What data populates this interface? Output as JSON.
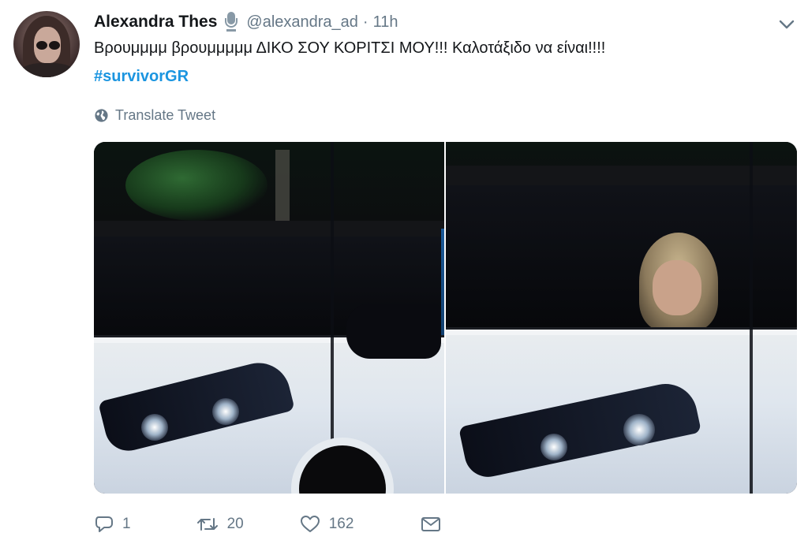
{
  "tweet": {
    "author_name": "Alexandra Thes",
    "handle": "@alexandra_ad",
    "separator": "·",
    "time": "11h",
    "text": "Βρουμμμμ βρουμμμμμ ΔΙΚΟ ΣΟΥ ΚΟΡΙΤΣΙ ΜΟΥ!!! Καλοτάξιδο να είναι!!!!",
    "hashtag": "#survivorGR",
    "translate_label": "Translate Tweet"
  },
  "actions": {
    "reply_count": "1",
    "retweet_count": "20",
    "like_count": "162"
  },
  "icons": {
    "author_badge": "microphone-icon",
    "more": "chevron-down-icon",
    "translate": "globe-icon",
    "reply": "reply-icon",
    "retweet": "retweet-icon",
    "like": "heart-icon",
    "message": "envelope-icon"
  },
  "colors": {
    "link": "#1b95e0",
    "secondary_text": "#657786",
    "icon": "#657786"
  }
}
